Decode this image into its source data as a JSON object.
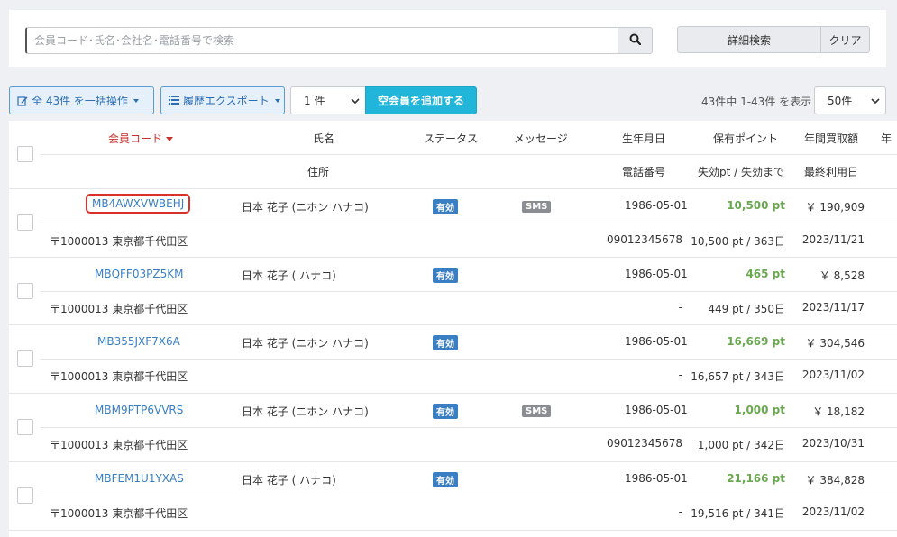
{
  "search": {
    "placeholder": "会員コード･氏名･会社名･電話番号で検索",
    "advanced_label": "詳細検索",
    "clear_label": "クリア"
  },
  "toolbar": {
    "bulk_label": "全 43件 を一括操作",
    "export_label": "履歴エクスポート",
    "count_value": "1 件",
    "add_empty_label": "空会員を追加する",
    "range_text": "43件中 1-43件 を表示",
    "per_page_value": "50件"
  },
  "table": {
    "headers": {
      "code": "会員コード",
      "name": "氏名",
      "status": "ステータス",
      "message": "メッセージ",
      "birthday": "生年月日",
      "points": "保有ポイント",
      "annual": "年間買取額",
      "extra": "年",
      "address": "住所",
      "phone": "電話番号",
      "expire": "失効pt / 失効まで",
      "last_used": "最終利用日"
    },
    "rows": [
      {
        "code": "MB4AWXVWBEHJ",
        "name": "日本 花子 (ニホン ハナコ)",
        "status": "有効",
        "message": "SMS",
        "birthday": "1986-05-01",
        "points": "10,500 pt",
        "annual": "￥ 190,909",
        "address": "〒1000013 東京都千代田区",
        "phone": "09012345678",
        "expire": "10,500 pt / 363日",
        "last_used": "2023/11/21"
      },
      {
        "code": "MBQFF03PZ5KM",
        "name": "日本 花子 ( ハナコ)",
        "status": "有効",
        "message": "",
        "birthday": "1986-05-01",
        "points": "465 pt",
        "annual": "￥ 8,528",
        "address": "〒1000013 東京都千代田区",
        "phone": "-",
        "expire": "449 pt / 350日",
        "last_used": "2023/11/17"
      },
      {
        "code": "MB355JXF7X6A",
        "name": "日本 花子 (ニホン ハナコ)",
        "status": "有効",
        "message": "",
        "birthday": "1986-05-01",
        "points": "16,669 pt",
        "annual": "￥ 304,546",
        "address": "〒1000013 東京都千代田区",
        "phone": "-",
        "expire": "16,657 pt / 343日",
        "last_used": "2023/11/02"
      },
      {
        "code": "MBM9PTP6VVRS",
        "name": "日本 花子 (ニホン ハナコ)",
        "status": "有効",
        "message": "SMS",
        "birthday": "1986-05-01",
        "points": "1,000 pt",
        "annual": "￥ 18,182",
        "address": "〒1000013 東京都千代田区",
        "phone": "09012345678",
        "expire": "1,000 pt / 342日",
        "last_used": "2023/10/31"
      },
      {
        "code": "MBFEM1U1YXAS",
        "name": "日本 花子 ( ハナコ)",
        "status": "有効",
        "message": "",
        "birthday": "1986-05-01",
        "points": "21,166 pt",
        "annual": "￥ 384,828",
        "address": "〒1000013 東京都千代田区",
        "phone": "-",
        "expire": "19,516 pt / 341日",
        "last_used": "2023/11/02"
      }
    ]
  },
  "icons": {
    "search": "search-icon",
    "edit": "edit-icon",
    "list": "list-icon"
  },
  "colors": {
    "accent": "#21b6d9",
    "link": "#3a7fc4",
    "sort_active": "#c9302c",
    "points": "#6aa84f"
  }
}
